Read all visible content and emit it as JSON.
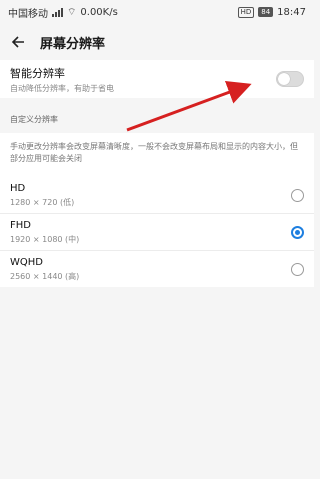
{
  "status_bar": {
    "carrier": "中国移动",
    "network_speed": "0.00K/s",
    "hd": "HD",
    "battery": "84",
    "time": "18:47"
  },
  "header": {
    "title": "屏幕分辨率"
  },
  "smart_resolution": {
    "title": "智能分辨率",
    "subtitle": "自动降低分辨率，有助于省电",
    "enabled": false
  },
  "custom": {
    "section_title": "自定义分辨率",
    "description": "手动更改分辨率会改变屏幕清晰度，一般不会改变屏幕布局和显示的内容大小，但部分应用可能会关闭",
    "options": [
      {
        "name": "HD",
        "resolution": "1280 × 720 (低)",
        "selected": false
      },
      {
        "name": "FHD",
        "resolution": "1920 × 1080 (中)",
        "selected": true
      },
      {
        "name": "WQHD",
        "resolution": "2560 × 1440 (高)",
        "selected": false
      }
    ]
  },
  "colors": {
    "accent": "#1e7fe0",
    "annotation_arrow": "#d62020"
  }
}
